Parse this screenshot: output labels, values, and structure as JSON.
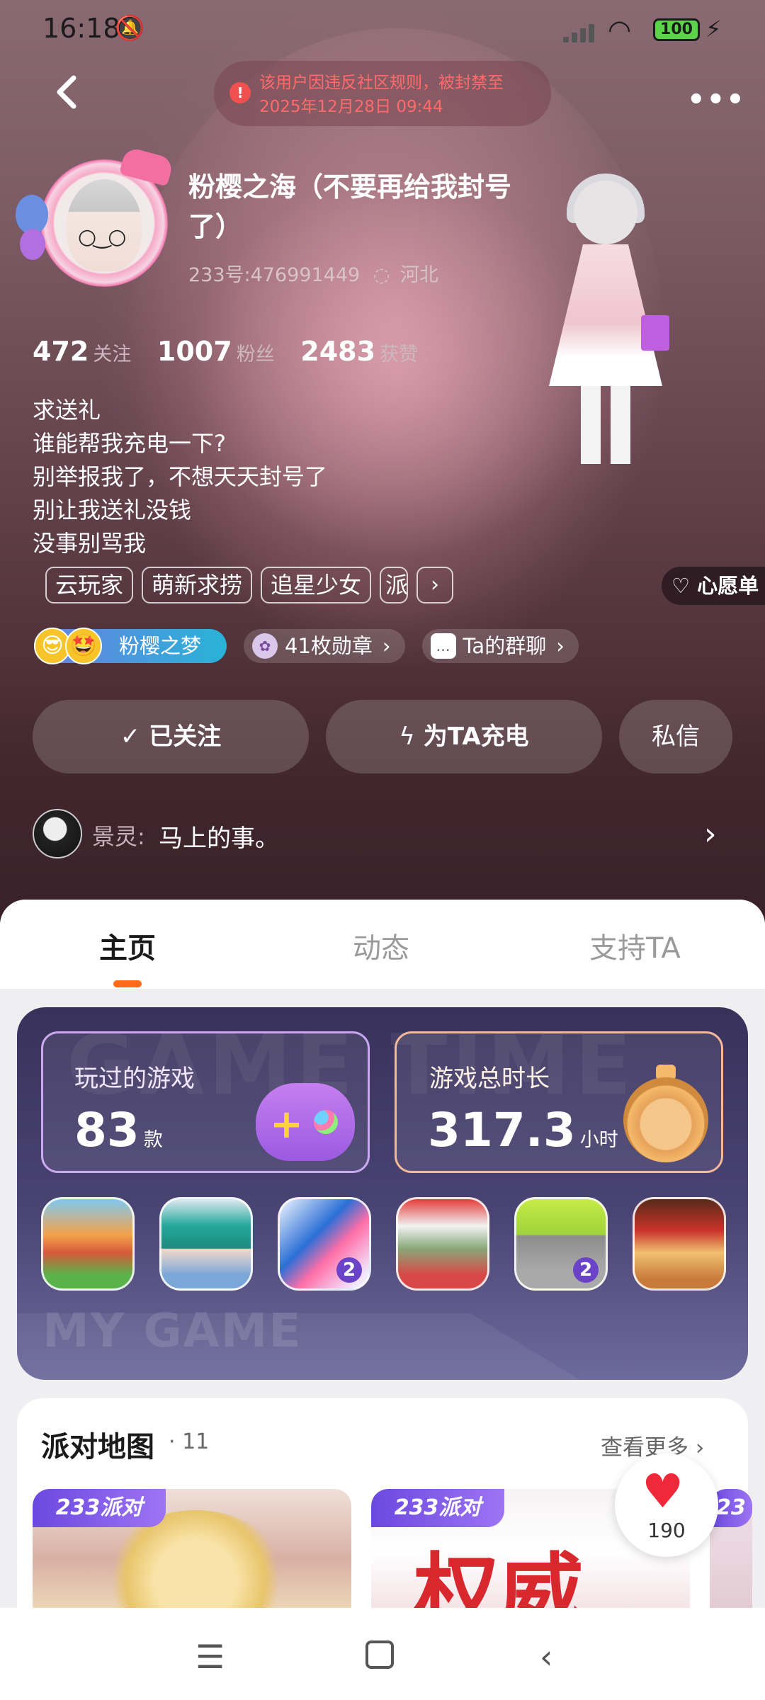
{
  "status_bar": {
    "time": "16:18",
    "battery": "100"
  },
  "ban_notice": {
    "line1": "该用户因违反社区规则，被封禁至",
    "line2": "2025年12月28日 09:44"
  },
  "profile": {
    "nickname": "粉樱之海（不要再给我封号了）",
    "uid": "233号:476991449",
    "location": "河北",
    "stats": {
      "following": "472",
      "following_label": "关注",
      "fans": "1007",
      "fans_label": "粉丝",
      "likes": "2483",
      "likes_label": "获赞"
    },
    "bio": [
      "求送礼",
      "谁能帮我充电一下?",
      "别举报我了，不想天天封号了",
      "别让我送礼没钱",
      "没事别骂我"
    ],
    "tags": [
      "云玩家",
      "萌新求捞",
      "追星少女",
      "派"
    ],
    "wishlist": "心愿单"
  },
  "badges": {
    "fan_group": "粉樱之梦",
    "medals": "41枚勋章",
    "group_chat": "Ta的群聊"
  },
  "actions": {
    "follow": "已关注",
    "charge": "为TA充电",
    "message": "私信"
  },
  "comment": {
    "name": "景灵:",
    "text": "马上的事。"
  },
  "tabs": [
    "主页",
    "动态",
    "支持TA"
  ],
  "games": {
    "watermark_top": "GAME TIME",
    "watermark_bottom": "MY GAME",
    "played_label": "玩过的游戏",
    "played_count": "83",
    "played_unit": "款",
    "time_label": "游戏总时长",
    "time_value": "317.3",
    "time_unit": "小时",
    "icons": [
      {
        "name": "town-game-icon",
        "badge": ""
      },
      {
        "name": "anime-girl-game-icon",
        "badge": ""
      },
      {
        "name": "talking-angela-2-icon",
        "badge": "2"
      },
      {
        "name": "talking-tom-friends-icon",
        "badge": ""
      },
      {
        "name": "talking-tom-2-icon",
        "badge": "2"
      },
      {
        "name": "shawarma-game-icon",
        "badge": ""
      }
    ]
  },
  "party_maps": {
    "title": "派对地图",
    "count": "· 11",
    "more": "查看更多 ›",
    "tag": "233派对"
  },
  "like_fab": {
    "count": "190"
  }
}
